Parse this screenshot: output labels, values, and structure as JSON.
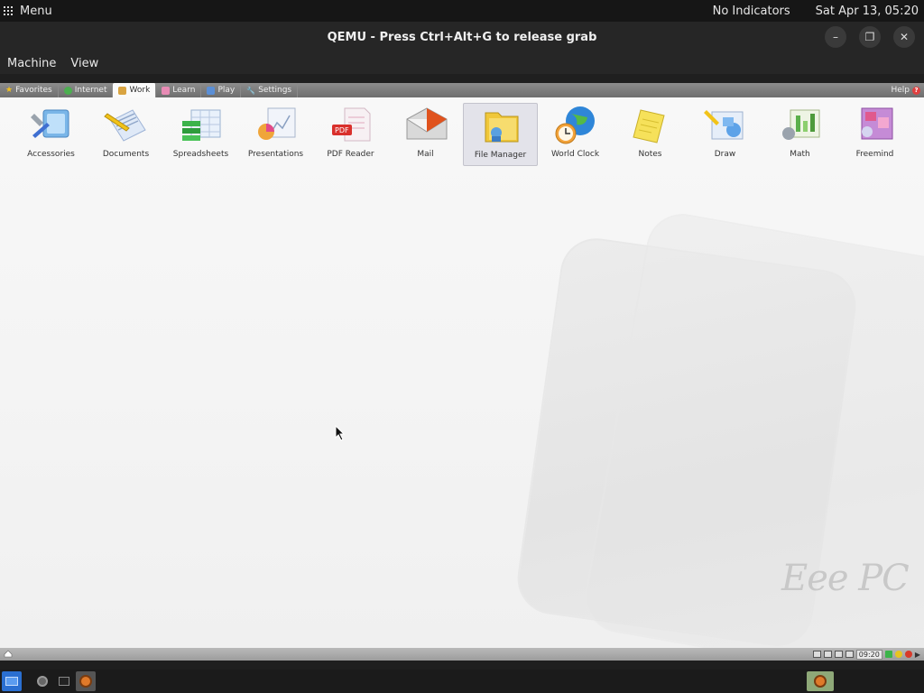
{
  "host_panel": {
    "menu_label": "Menu",
    "indicators": "No Indicators",
    "datetime": "Sat Apr 13, 05:20"
  },
  "titlebar": {
    "title": "QEMU - Press Ctrl+Alt+G to release grab"
  },
  "qemu_menu": {
    "items": [
      "Machine",
      "View"
    ]
  },
  "guest": {
    "tabs": [
      {
        "label": "Favorites",
        "icon": "star-icon",
        "active": false
      },
      {
        "label": "Internet",
        "icon": "globe-icon",
        "active": false
      },
      {
        "label": "Work",
        "icon": "briefcase-icon",
        "active": true
      },
      {
        "label": "Learn",
        "icon": "book-icon",
        "active": false
      },
      {
        "label": "Play",
        "icon": "controller-icon",
        "active": false
      },
      {
        "label": "Settings",
        "icon": "wrench-icon",
        "active": false
      }
    ],
    "help_label": "Help",
    "apps": [
      {
        "label": "Accessories",
        "icon": "accessories-icon",
        "selected": false
      },
      {
        "label": "Documents",
        "icon": "documents-icon",
        "selected": false
      },
      {
        "label": "Spreadsheets",
        "icon": "spreadsheets-icon",
        "selected": false
      },
      {
        "label": "Presentations",
        "icon": "presentations-icon",
        "selected": false
      },
      {
        "label": "PDF Reader",
        "icon": "pdf-reader-icon",
        "selected": false
      },
      {
        "label": "Mail",
        "icon": "mail-icon",
        "selected": false
      },
      {
        "label": "File Manager",
        "icon": "file-manager-icon",
        "selected": true
      },
      {
        "label": "World Clock",
        "icon": "world-clock-icon",
        "selected": false
      },
      {
        "label": "Notes",
        "icon": "notes-icon",
        "selected": false
      },
      {
        "label": "Draw",
        "icon": "draw-icon",
        "selected": false
      },
      {
        "label": "Math",
        "icon": "math-icon",
        "selected": false
      },
      {
        "label": "Freemind",
        "icon": "freemind-icon",
        "selected": false
      }
    ],
    "brand_logo": "Eee PC",
    "taskbar": {
      "clock": "09:20"
    }
  },
  "colors": {
    "guest_bg": "#f4f4f4",
    "tabbar": "#7d7d7d",
    "selected_app": "#e3e3ea"
  }
}
